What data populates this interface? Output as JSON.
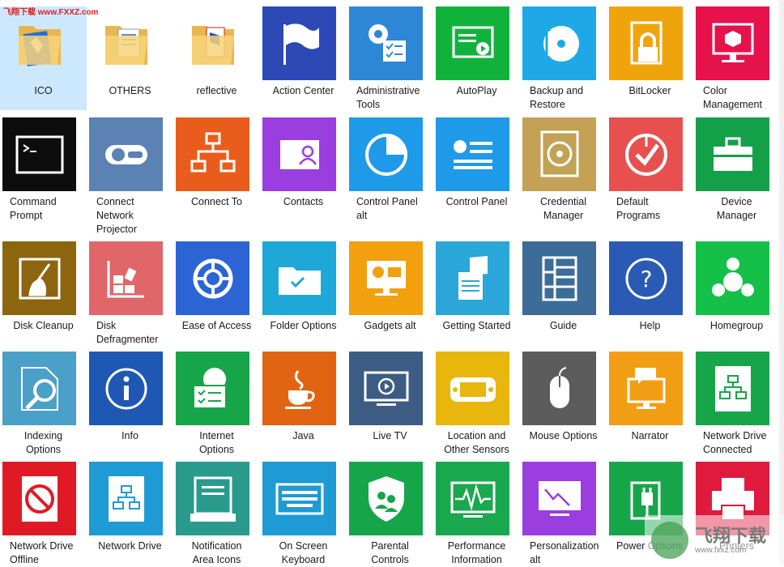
{
  "watermark_top": "飞翔下载 www.FXXZ.com",
  "watermark_bottom": {
    "title": "飞翔下载",
    "url": "www.fxxz.com"
  },
  "colors": {
    "selected_folder": "#cce8ff"
  },
  "items": [
    {
      "label": "ICO",
      "kind": "folder",
      "selected": true
    },
    {
      "label": "OTHERS",
      "kind": "folder"
    },
    {
      "label": "reflective",
      "kind": "folder"
    },
    {
      "label": "Action Center",
      "color": "#2c49b5",
      "icon": "flag-icon"
    },
    {
      "label": "Administrative\nTools",
      "color": "#2e86d6",
      "icon": "gear-checklist-icon",
      "align": "left"
    },
    {
      "label": "AutoPlay",
      "color": "#11b23c",
      "icon": "play-window-icon"
    },
    {
      "label": "Backup and\nRestore",
      "color": "#1ea8e8",
      "icon": "disc-arrows-icon",
      "align": "left"
    },
    {
      "label": "BitLocker",
      "color": "#f0a40c",
      "icon": "lock-icon"
    },
    {
      "label": "Color\nManagement",
      "color": "#e5124b",
      "icon": "monitor-cube-icon",
      "align": "left"
    },
    {
      "label": "Command\nPrompt",
      "color": "#0d0d0d",
      "icon": "terminal-icon",
      "align": "left"
    },
    {
      "label": "Connect\nNetwork\nProjector",
      "color": "#5c82b4",
      "icon": "projector-icon",
      "align": "left"
    },
    {
      "label": "Connect To",
      "color": "#ea5c1c",
      "icon": "network-tree-icon"
    },
    {
      "label": "Contacts",
      "color": "#9a3ee0",
      "icon": "contact-card-icon"
    },
    {
      "label": "Control Panel\nalt",
      "color": "#1e9ae8",
      "icon": "pie-chart-icon",
      "align": "left"
    },
    {
      "label": "Control Panel",
      "color": "#1e9ae8",
      "icon": "control-list-icon"
    },
    {
      "label": "Credential\nManager",
      "color": "#c3a256",
      "icon": "safe-icon"
    },
    {
      "label": "Default\nPrograms",
      "color": "#e85050",
      "icon": "check-target-icon",
      "align": "left"
    },
    {
      "label": "Device\nManager",
      "color": "#14a049",
      "icon": "toolbox-icon"
    },
    {
      "label": "Disk Cleanup",
      "color": "#8c650e",
      "icon": "broom-icon"
    },
    {
      "label": "Disk\nDefragmenter",
      "color": "#e0666a",
      "icon": "defrag-icon",
      "align": "left"
    },
    {
      "label": "Ease of Access",
      "color": "#2c64d4",
      "icon": "accessibility-icon"
    },
    {
      "label": "Folder Options",
      "color": "#1ea8d8",
      "icon": "folder-check-icon"
    },
    {
      "label": "Gadgets alt",
      "color": "#f2a00e",
      "icon": "gadgets-icon"
    },
    {
      "label": "Getting Started",
      "color": "#2aa6d8",
      "icon": "windows-doc-icon"
    },
    {
      "label": "Guide",
      "color": "#3c6c98",
      "icon": "grid-guide-icon"
    },
    {
      "label": "Help",
      "color": "#2a5ab4",
      "icon": "question-icon"
    },
    {
      "label": "Homegroup",
      "color": "#14c048",
      "icon": "homegroup-icon"
    },
    {
      "label": "Indexing\nOptions",
      "color": "#4aa0c8",
      "icon": "magnifier-icon"
    },
    {
      "label": "Info",
      "color": "#1e58b4",
      "icon": "info-icon"
    },
    {
      "label": "Internet\nOptions",
      "color": "#17a54a",
      "icon": "globe-list-icon"
    },
    {
      "label": "Java",
      "color": "#e06412",
      "icon": "java-cup-icon"
    },
    {
      "label": "Live TV",
      "color": "#3c5c84",
      "icon": "tv-icon"
    },
    {
      "label": "Location and\nOther Sensors",
      "color": "#e8b60c",
      "icon": "handheld-icon"
    },
    {
      "label": "Mouse Options",
      "color": "#5c5c5c",
      "icon": "mouse-icon"
    },
    {
      "label": "Narrator",
      "color": "#f29e14",
      "icon": "speech-monitor-icon"
    },
    {
      "label": "Network Drive\nConnected",
      "color": "#17a54a",
      "icon": "network-drive-icon",
      "align": "left"
    },
    {
      "label": "Network Drive\nOffline",
      "color": "#e01a24",
      "icon": "drive-offline-icon",
      "align": "left"
    },
    {
      "label": "Network Drive",
      "color": "#1e9ad4",
      "icon": "drive-network-icon"
    },
    {
      "label": "Notification\nArea Icons",
      "color": "#2a9a8c",
      "icon": "taskbar-icon"
    },
    {
      "label": "On Screen\nKeyboard",
      "color": "#1e9ad4",
      "icon": "keyboard-icon"
    },
    {
      "label": "Parental\nControls",
      "color": "#17a54a",
      "icon": "shield-users-icon"
    },
    {
      "label": "Performance\nInformation",
      "color": "#1aa84e",
      "icon": "waveform-icon"
    },
    {
      "label": "Personalization\nalt",
      "color": "#9a3ee0",
      "icon": "monitor-paint-icon",
      "align": "left"
    },
    {
      "label": "Power Options",
      "color": "#17a54a",
      "icon": "power-plug-icon",
      "align": "left"
    },
    {
      "label": "Printers",
      "color": "#e01a3c",
      "icon": "printer-icon"
    }
  ]
}
